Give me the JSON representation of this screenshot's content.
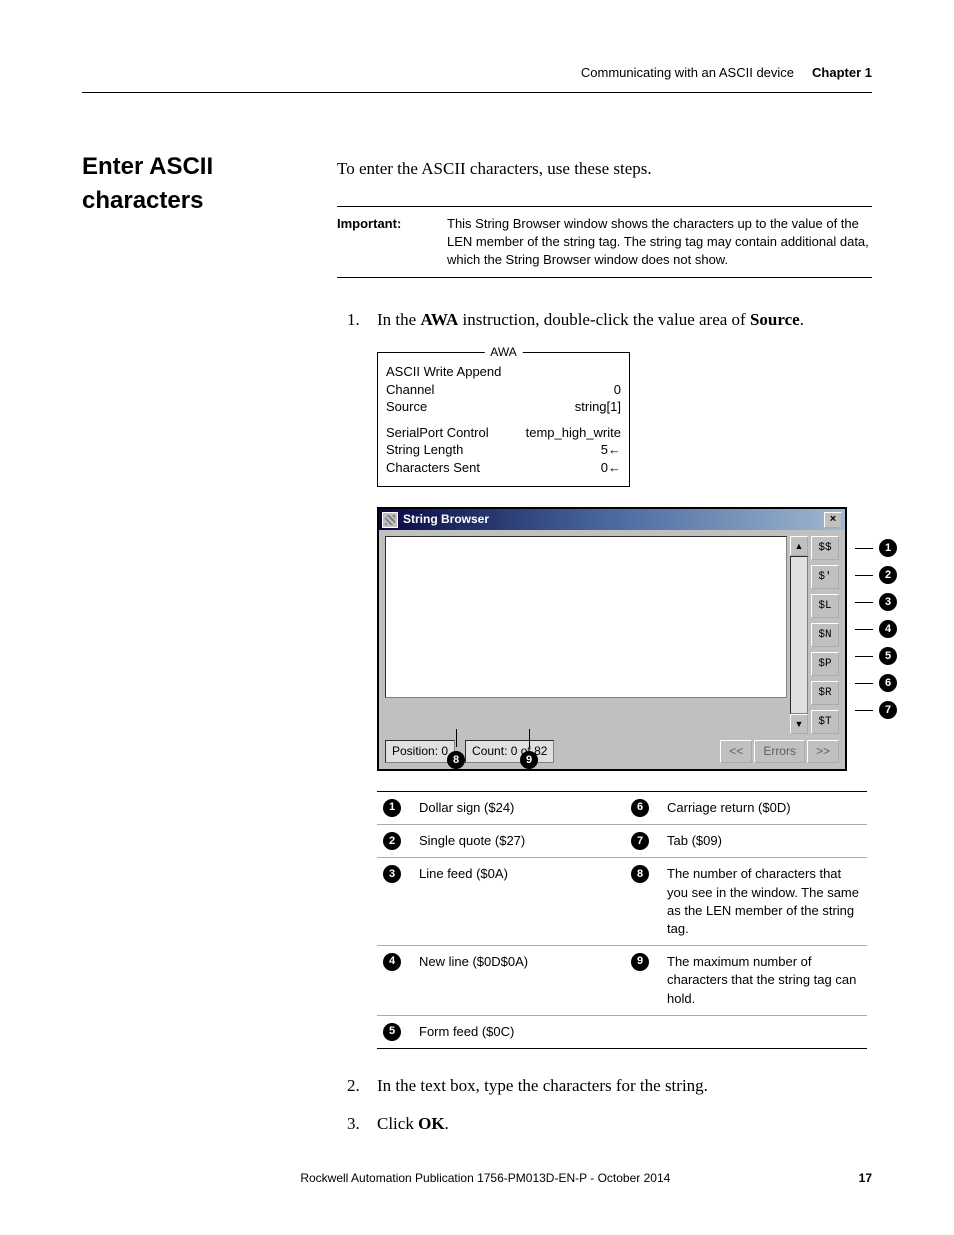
{
  "header": {
    "doc_title": "Communicating with an ASCII device",
    "chapter": "Chapter 1"
  },
  "section_heading": "Enter ASCII characters",
  "intro": "To enter the ASCII characters, use these steps.",
  "important": {
    "label": "Important:",
    "text": "This String Browser window shows the characters up to the value of the LEN member of the string tag. The string tag may contain additional data, which the String Browser window does not show."
  },
  "steps": {
    "s1": {
      "num": "1.",
      "pre": "In the ",
      "b1": "AWA",
      "mid": " instruction, double-click the value area of ",
      "b2": "Source",
      "end": "."
    },
    "s2": {
      "num": "2.",
      "text": "In the text box, type the characters for the string."
    },
    "s3": {
      "num": "3.",
      "pre": "Click ",
      "b1": "OK",
      "end": "."
    }
  },
  "awa": {
    "title": "AWA",
    "name": "ASCII Write Append",
    "rows": {
      "channel": {
        "label": "Channel",
        "value": "0"
      },
      "source": {
        "label": "Source",
        "value": "string[1]"
      },
      "spc": {
        "label": "SerialPort Control",
        "value": "temp_high_write"
      },
      "slen": {
        "label": "String Length",
        "value": "5",
        "arrow": "←"
      },
      "csent": {
        "label": "Characters Sent",
        "value": "0",
        "arrow": "←"
      }
    }
  },
  "string_browser": {
    "title": "String Browser",
    "close": "×",
    "scroll_up": "▲",
    "scroll_down": "▼",
    "side_buttons": [
      "$$",
      "$'",
      "$L",
      "$N",
      "$P",
      "$R",
      "$T"
    ],
    "position_label": "Position: 0",
    "count_label": "Count: 0 of 82",
    "prev": "<<",
    "errors": "Errors",
    "next": ">>"
  },
  "side_callouts": [
    "1",
    "2",
    "3",
    "4",
    "5",
    "6",
    "7"
  ],
  "bottom_callouts": [
    "8",
    "9"
  ],
  "legend": {
    "r1": {
      "n": "1",
      "t": "Dollar sign ($24)"
    },
    "r2": {
      "n": "2",
      "t": "Single quote ($27)"
    },
    "r3": {
      "n": "3",
      "t": "Line feed ($0A)"
    },
    "r4": {
      "n": "4",
      "t": "New line ($0D$0A)"
    },
    "r5": {
      "n": "5",
      "t": "Form feed ($0C)"
    },
    "r6": {
      "n": "6",
      "t": "Carriage return ($0D)"
    },
    "r7": {
      "n": "7",
      "t": "Tab ($09)"
    },
    "r8": {
      "n": "8",
      "t": "The number of characters that you see in the window. The same as the LEN member of the string tag."
    },
    "r9": {
      "n": "9",
      "t": "The maximum number of characters that the string tag can hold."
    }
  },
  "footer": {
    "publication": "Rockwell Automation Publication 1756-PM013D-EN-P - October 2014",
    "page": "17"
  }
}
